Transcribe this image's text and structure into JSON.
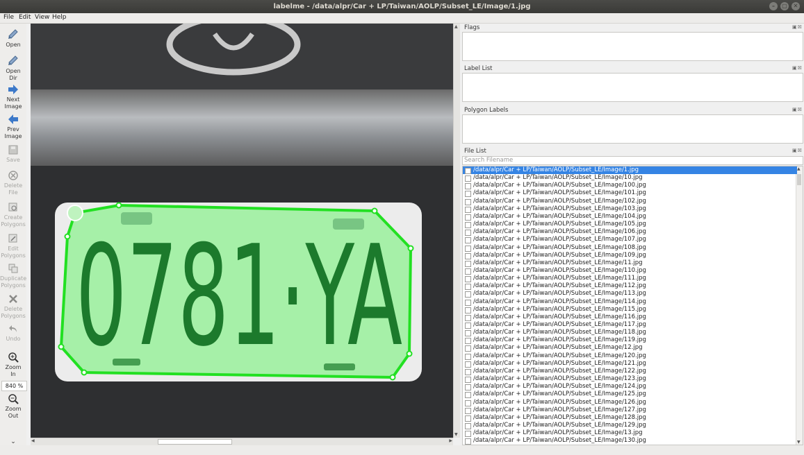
{
  "window": {
    "title": "labelme - /data/alpr/Car + LP/Taiwan/AOLP/Subset_LE/Image/1.jpg"
  },
  "menu": [
    "File",
    "Edit",
    "View",
    "Help"
  ],
  "toolbar": [
    {
      "label_lines": [
        "Open"
      ],
      "icon": "open-icon",
      "enabled": true
    },
    {
      "label_lines": [
        "Open",
        "Dir"
      ],
      "icon": "open-dir-icon",
      "enabled": true
    },
    {
      "label_lines": [
        "Next",
        "Image"
      ],
      "icon": "next-icon",
      "enabled": true
    },
    {
      "label_lines": [
        "Prev",
        "Image"
      ],
      "icon": "prev-icon",
      "enabled": true
    },
    {
      "label_lines": [
        "Save"
      ],
      "icon": "save-icon",
      "enabled": false
    },
    {
      "label_lines": [
        "Delete",
        "File"
      ],
      "icon": "delete-file-icon",
      "enabled": false
    },
    {
      "label_lines": [
        "Create",
        "Polygons"
      ],
      "icon": "create-polygon-icon",
      "enabled": false
    },
    {
      "label_lines": [
        "Edit",
        "Polygons"
      ],
      "icon": "edit-polygon-icon",
      "enabled": false
    },
    {
      "label_lines": [
        "Duplicate",
        "Polygons"
      ],
      "icon": "duplicate-icon",
      "enabled": false
    },
    {
      "label_lines": [
        "Delete",
        "Polygons"
      ],
      "icon": "delete-polygon-icon",
      "enabled": false
    },
    {
      "label_lines": [
        "Undo"
      ],
      "icon": "undo-icon",
      "enabled": false
    },
    {
      "label_lines": [
        "Zoom",
        "In"
      ],
      "icon": "zoom-in-icon",
      "enabled": true
    },
    {
      "label_lines": [
        "Zoom",
        "Out"
      ],
      "icon": "zoom-out-icon",
      "enabled": true
    }
  ],
  "zoom": "840 %",
  "plate_text": "0781·YA",
  "docks": {
    "flags": "Flags",
    "label_list": "Label List",
    "polygon_labels": "Polygon Labels",
    "file_list": "File List"
  },
  "search": {
    "placeholder": "Search Filename"
  },
  "files": [
    "/data/alpr/Car + LP/Taiwan/AOLP/Subset_LE/Image/1.jpg",
    "/data/alpr/Car + LP/Taiwan/AOLP/Subset_LE/Image/10.jpg",
    "/data/alpr/Car + LP/Taiwan/AOLP/Subset_LE/Image/100.jpg",
    "/data/alpr/Car + LP/Taiwan/AOLP/Subset_LE/Image/101.jpg",
    "/data/alpr/Car + LP/Taiwan/AOLP/Subset_LE/Image/102.jpg",
    "/data/alpr/Car + LP/Taiwan/AOLP/Subset_LE/Image/103.jpg",
    "/data/alpr/Car + LP/Taiwan/AOLP/Subset_LE/Image/104.jpg",
    "/data/alpr/Car + LP/Taiwan/AOLP/Subset_LE/Image/105.jpg",
    "/data/alpr/Car + LP/Taiwan/AOLP/Subset_LE/Image/106.jpg",
    "/data/alpr/Car + LP/Taiwan/AOLP/Subset_LE/Image/107.jpg",
    "/data/alpr/Car + LP/Taiwan/AOLP/Subset_LE/Image/108.jpg",
    "/data/alpr/Car + LP/Taiwan/AOLP/Subset_LE/Image/109.jpg",
    "/data/alpr/Car + LP/Taiwan/AOLP/Subset_LE/Image/11.jpg",
    "/data/alpr/Car + LP/Taiwan/AOLP/Subset_LE/Image/110.jpg",
    "/data/alpr/Car + LP/Taiwan/AOLP/Subset_LE/Image/111.jpg",
    "/data/alpr/Car + LP/Taiwan/AOLP/Subset_LE/Image/112.jpg",
    "/data/alpr/Car + LP/Taiwan/AOLP/Subset_LE/Image/113.jpg",
    "/data/alpr/Car + LP/Taiwan/AOLP/Subset_LE/Image/114.jpg",
    "/data/alpr/Car + LP/Taiwan/AOLP/Subset_LE/Image/115.jpg",
    "/data/alpr/Car + LP/Taiwan/AOLP/Subset_LE/Image/116.jpg",
    "/data/alpr/Car + LP/Taiwan/AOLP/Subset_LE/Image/117.jpg",
    "/data/alpr/Car + LP/Taiwan/AOLP/Subset_LE/Image/118.jpg",
    "/data/alpr/Car + LP/Taiwan/AOLP/Subset_LE/Image/119.jpg",
    "/data/alpr/Car + LP/Taiwan/AOLP/Subset_LE/Image/12.jpg",
    "/data/alpr/Car + LP/Taiwan/AOLP/Subset_LE/Image/120.jpg",
    "/data/alpr/Car + LP/Taiwan/AOLP/Subset_LE/Image/121.jpg",
    "/data/alpr/Car + LP/Taiwan/AOLP/Subset_LE/Image/122.jpg",
    "/data/alpr/Car + LP/Taiwan/AOLP/Subset_LE/Image/123.jpg",
    "/data/alpr/Car + LP/Taiwan/AOLP/Subset_LE/Image/124.jpg",
    "/data/alpr/Car + LP/Taiwan/AOLP/Subset_LE/Image/125.jpg",
    "/data/alpr/Car + LP/Taiwan/AOLP/Subset_LE/Image/126.jpg",
    "/data/alpr/Car + LP/Taiwan/AOLP/Subset_LE/Image/127.jpg",
    "/data/alpr/Car + LP/Taiwan/AOLP/Subset_LE/Image/128.jpg",
    "/data/alpr/Car + LP/Taiwan/AOLP/Subset_LE/Image/129.jpg",
    "/data/alpr/Car + LP/Taiwan/AOLP/Subset_LE/Image/13.jpg",
    "/data/alpr/Car + LP/Taiwan/AOLP/Subset_LE/Image/130.jpg"
  ],
  "selected_file_index": 0,
  "colors": {
    "selection": "#3584e4",
    "polygon": "#22e022",
    "plate_fill": "#a6f0a8"
  }
}
